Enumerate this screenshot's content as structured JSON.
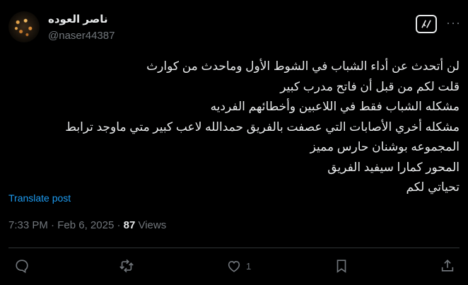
{
  "author": {
    "name": "ناصر العوده",
    "handle": "@naser44387"
  },
  "tweet": {
    "lines": [
      "لن أتحدث عن أداء الشباب في الشوط الأول وماحدث من كوارث",
      "قلت لكم من قبل أن فاتح مدرب كبير",
      "مشكله الشباب فقط في اللاعبين وأخطائهم الفرديه",
      "مشكله أخري الأصابات التي عصفت بالفريق حمدالله لاعب كبير متي ماوجد ترابط",
      "المجموعه بوشنان حارس مميز",
      "المحور كمارا سيفيد الفريق",
      "تحياتي لكم"
    ],
    "translate_label": "Translate post",
    "time": "7:33 PM",
    "date": "Feb 6, 2025",
    "separator": "·",
    "views_count": "87",
    "views_label": "Views"
  },
  "actions": {
    "reply_icon": "reply-icon",
    "retweet_icon": "retweet-icon",
    "like_icon": "heart-icon",
    "like_count": "1",
    "bookmark_icon": "bookmark-icon",
    "share_icon": "share-icon"
  },
  "colors": {
    "background": "#000000",
    "text": "#e7e9ea",
    "secondary": "#71767b",
    "link": "#1d9bf0"
  }
}
